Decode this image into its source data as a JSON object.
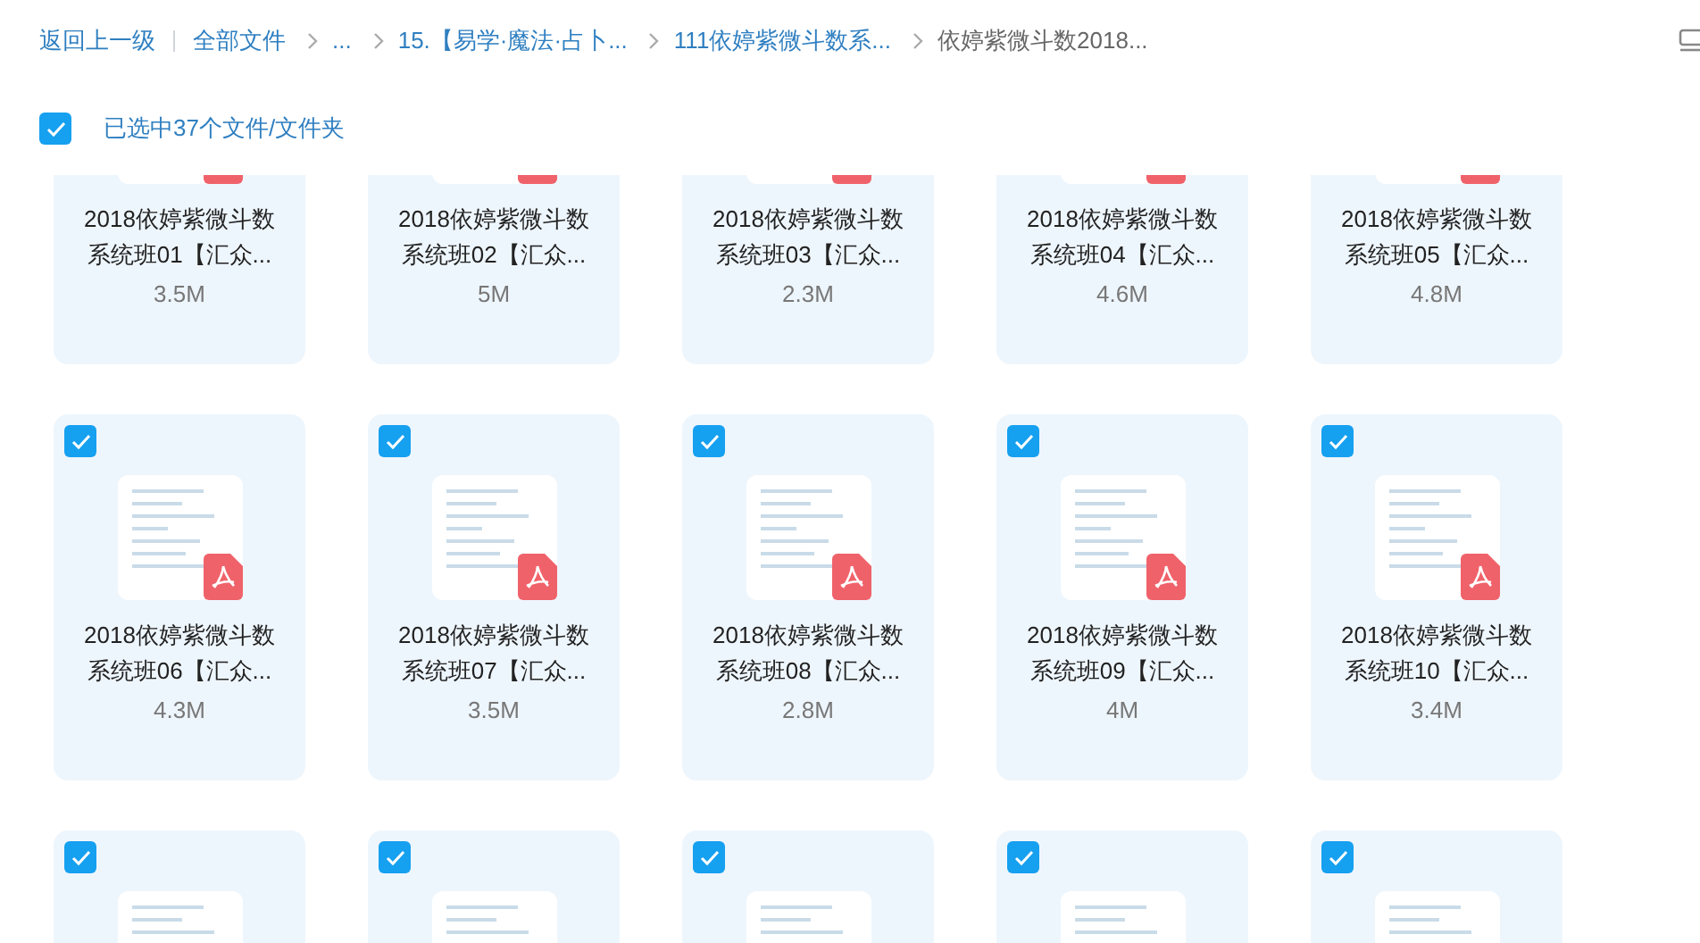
{
  "breadcrumb": {
    "back": "返回上一级",
    "items": [
      {
        "label": "全部文件",
        "current": false
      },
      {
        "label": "...",
        "current": false
      },
      {
        "label": "15.【易学·魔法·占卜...",
        "current": false
      },
      {
        "label": "111依婷紫微斗数系...",
        "current": false
      },
      {
        "label": "依婷紫微斗数2018...",
        "current": true
      }
    ]
  },
  "selection": {
    "checked": true,
    "label": "已选中37个文件/文件夹"
  },
  "files": [
    {
      "name": [
        "2018依婷紫微斗数",
        "系统班01【汇众..."
      ],
      "size": "3.5M",
      "selected": true
    },
    {
      "name": [
        "2018依婷紫微斗数",
        "系统班02【汇众..."
      ],
      "size": "5M",
      "selected": true
    },
    {
      "name": [
        "2018依婷紫微斗数",
        "系统班03【汇众..."
      ],
      "size": "2.3M",
      "selected": true
    },
    {
      "name": [
        "2018依婷紫微斗数",
        "系统班04【汇众..."
      ],
      "size": "4.6M",
      "selected": true
    },
    {
      "name": [
        "2018依婷紫微斗数",
        "系统班05【汇众..."
      ],
      "size": "4.8M",
      "selected": true
    },
    {
      "name": [
        "2018依婷紫微斗数",
        "系统班06【汇众..."
      ],
      "size": "4.3M",
      "selected": true
    },
    {
      "name": [
        "2018依婷紫微斗数",
        "系统班07【汇众..."
      ],
      "size": "3.5M",
      "selected": true
    },
    {
      "name": [
        "2018依婷紫微斗数",
        "系统班08【汇众..."
      ],
      "size": "2.8M",
      "selected": true
    },
    {
      "name": [
        "2018依婷紫微斗数",
        "系统班09【汇众..."
      ],
      "size": "4M",
      "selected": true
    },
    {
      "name": [
        "2018依婷紫微斗数",
        "系统班10【汇众..."
      ],
      "size": "3.4M",
      "selected": true
    },
    {
      "selected": true
    },
    {
      "selected": true
    },
    {
      "selected": true
    },
    {
      "selected": true
    },
    {
      "selected": true
    }
  ]
}
